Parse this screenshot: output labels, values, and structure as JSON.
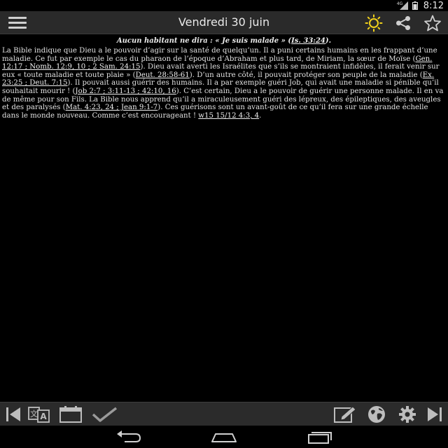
{
  "status_bar": {
    "network_label": "4G",
    "time": "8:12",
    "icons": [
      "signal-icon",
      "battery-icon"
    ]
  },
  "action_bar": {
    "title": "Vendredi 30 juin",
    "icons": [
      "menu-icon",
      "sun-icon",
      "share-icon",
      "star-icon"
    ],
    "accent_color": "#f2d21b"
  },
  "daily_text": {
    "theme_text": "Aucun habitant ne dira : « Je suis malade » (",
    "theme_ref": "Is. 33:24",
    "theme_end": ").",
    "s1": "La Bible indique que Dieu a le pouvoir d’agir sur la santé de quelqu’un. Il a puni certains humains en les frappant d’une maladie. Ce fut par exemple le cas du pharaon de l’époque d’Abraham et plus tard, de Miriam, la sœur de Moïse (",
    "r1": "Gen. 12:17 ; Nomb. 12:9, 10 ; 2 Sam. 24:15",
    "s2": "). Dieu avait averti les Israélites que s’ils se montraient infidèles, il ferait venir sur eux « toute maladie et toute plaie » (",
    "r2": "Deut. 28:58-61",
    "s3": "). D’un autre côté, il pouvait protéger son peuple de la maladie (",
    "r3": "Ex. 23:25 ; Deut. 7:15",
    "s4": "). Il pouvait aussi guérir des humains. Il a par exemple guéri Job, qui avait une maladie si pénible qu’il souhaitait mourir ! (",
    "r4": "Job 2:7 ; 3:11-13 ; 42:10, 16",
    "s5": "). C’est certain, Dieu a le pouvoir de guérir une personne malade. Il en va de même pour son Fils. La Bible nous apprend qu’il a miraculeusement guéri des lépreux, des épileptiques, des aveugles et des paralysés (",
    "r5": "Mat. 4:23, 24 ; Jean 9:1-7",
    "s6": "). Ces guérisons sont un avant-goût de ce qu’il fera sur une grande échelle dans le monde nouveau. Comme c’est encourageant ! ",
    "r6": "w15 15/12 4:3, 4",
    "s7": "."
  },
  "bottom_toolbar": {
    "icons": [
      "first-page-icon",
      "translate-icon",
      "calendar-icon",
      "check-icon",
      "edit-icon",
      "globe-icon",
      "gear-icon",
      "last-page-icon"
    ]
  },
  "nav_bar": {
    "icons": [
      "back-icon",
      "home-icon",
      "recents-icon"
    ]
  }
}
